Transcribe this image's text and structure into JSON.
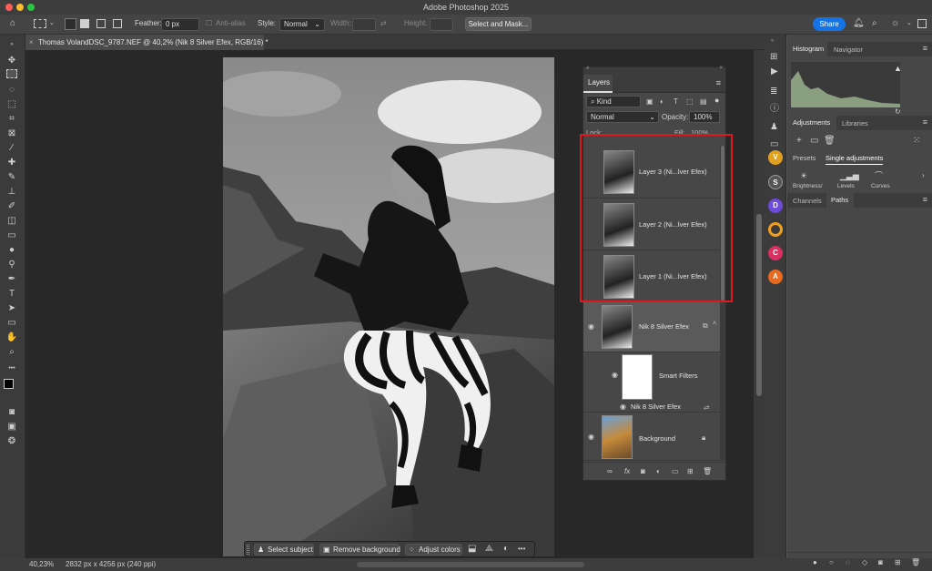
{
  "app": {
    "title": "Adobe Photoshop 2025"
  },
  "options": {
    "feather_label": "Feather:",
    "feather_value": "0 px",
    "antialias_label": "Anti-alias",
    "style_label": "Style:",
    "style_value": "Normal",
    "width_label": "Width:",
    "height_label": "Height:",
    "select_mask": "Select and Mask...",
    "share": "Share"
  },
  "document": {
    "tab_title": "Thomas VolandDSC_9787.NEF @ 40,2% (Nik 8 Silver Efex, RGB/16) *",
    "close_glyph": "×"
  },
  "taskbar": {
    "select_subject": "Select subject",
    "remove_background": "Remove background",
    "adjust_colors": "Adjust colors",
    "more": "•••"
  },
  "status": {
    "zoom": "40,23%",
    "dimensions": "2832 px x 4256 px (240 ppi)"
  },
  "layers_panel": {
    "tab": "Layers",
    "kind": "Kind",
    "blend_mode": "Normal",
    "opacity_label": "Opacity:",
    "opacity_value": "100%",
    "lock_label": "Lock:",
    "fill_label": "Fill:",
    "fill_value": "100%",
    "layers": [
      {
        "name": "Layer 3 (Ni...lver Efex)"
      },
      {
        "name": "Layer 2 (Ni...lver Efex)"
      },
      {
        "name": "Layer 1 (Ni...lver Efex)"
      },
      {
        "name": "Nik 8 Silver Efex"
      },
      {
        "name": "Smart Filters"
      },
      {
        "name": "Nik 8 Silver Efex"
      },
      {
        "name": "Background"
      }
    ],
    "highlight_color": "#e0181e"
  },
  "right_panels": {
    "histogram_tab": "Histogram",
    "navigator_tab": "Navigator",
    "adjustments_tab": "Adjustments",
    "libraries_tab": "Libraries",
    "presets_tab": "Presets",
    "single_adjustments_tab": "Single adjustments",
    "brightness": "Brightness/",
    "levels": "Levels",
    "curves": "Curves",
    "channels_tab": "Channels",
    "paths_tab": "Paths"
  },
  "dock_icons": [
    "V",
    "S",
    "D",
    "C",
    "A"
  ]
}
